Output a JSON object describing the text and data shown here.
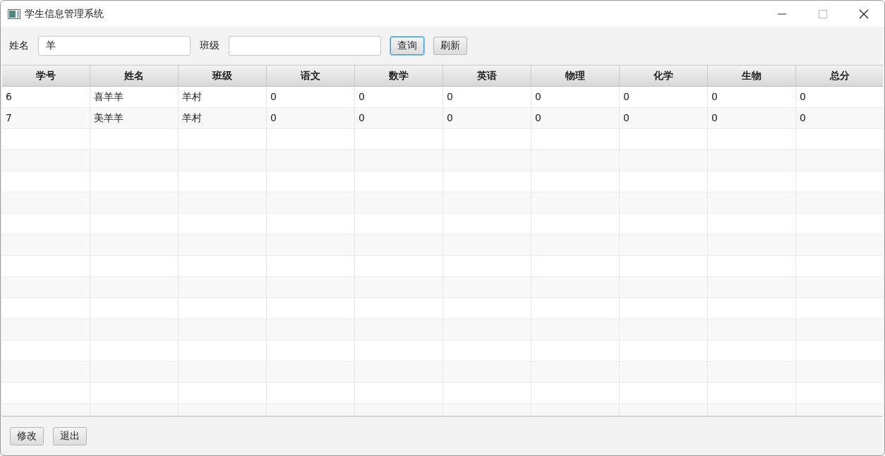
{
  "window": {
    "title": "学生信息管理系统"
  },
  "search": {
    "fields": [
      {
        "label": "姓名",
        "value": "羊"
      },
      {
        "label": "班级"
      }
    ],
    "buttons": [
      {
        "label": "查询",
        "focused": true
      },
      {
        "label": "刷新",
        "focused": false
      }
    ]
  },
  "table": {
    "columns": [
      "学号",
      "姓名",
      "班级",
      "语文",
      "数学",
      "英语",
      "物理",
      "化学",
      "生物",
      "总分"
    ],
    "rows": [
      [
        "6",
        "喜羊羊",
        "羊村",
        "0",
        "0",
        "0",
        "0",
        "0",
        "0",
        "0"
      ],
      [
        "7",
        "美羊羊",
        "羊村",
        "0",
        "0",
        "0",
        "0",
        "0",
        "0",
        "0"
      ]
    ]
  },
  "footer_buttons": [
    "修改",
    "退出"
  ]
}
